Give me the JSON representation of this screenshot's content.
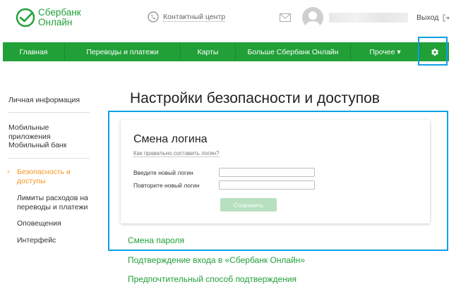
{
  "brand": {
    "line1": "Сбербанк",
    "line2": "Онлайн",
    "color": "#21a038"
  },
  "header": {
    "contact_label": "Контактный центр",
    "logout_label": "Выход"
  },
  "nav": {
    "items": [
      {
        "label": "Главная"
      },
      {
        "label": "Переводы и платежи"
      },
      {
        "label": "Карты"
      },
      {
        "label": "Больше Сбербанк Онлайн"
      },
      {
        "label": "Прочее ▾"
      }
    ],
    "settings_icon": "gear-icon"
  },
  "sidebar": {
    "items": [
      {
        "label": "Личная информация"
      },
      {
        "label": "Мобильные приложения"
      },
      {
        "label": "Мобильный банк"
      },
      {
        "label": "Безопасность и доступы",
        "active": true
      },
      {
        "label": "Лимиты расходов на переводы и платежи"
      },
      {
        "label": "Оповещения"
      },
      {
        "label": "Интерфейс"
      }
    ],
    "active_color": "#f7941d"
  },
  "main": {
    "title": "Настройки безопасности и доступов",
    "login_card": {
      "title": "Смена логина",
      "help_link": "Как правильно составить логин?",
      "new_login_label": "Введите новый логин",
      "repeat_login_label": "Повторите новый логин",
      "new_login_value": "",
      "repeat_login_value": "",
      "save_label": "Сохранить"
    },
    "links": [
      {
        "label": "Смена пароля"
      },
      {
        "label": "Подтверждение входа в «Сбербанк Онлайн»"
      },
      {
        "label": "Предпочтительный способ подтверждения"
      }
    ]
  },
  "highlight_color": "#0ea0e6"
}
